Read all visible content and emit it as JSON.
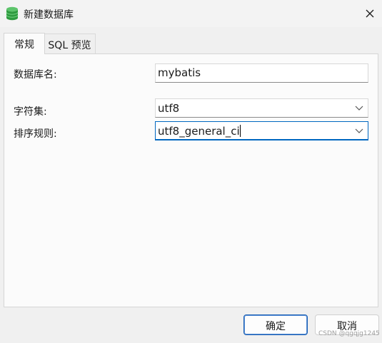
{
  "window": {
    "title": "新建数据库",
    "icon": "database-icon",
    "close_icon": "close-icon"
  },
  "tabs": [
    {
      "label": "常规",
      "active": true
    },
    {
      "label": "SQL 预览",
      "active": false
    }
  ],
  "form": {
    "db_name": {
      "label": "数据库名:",
      "value": "mybatis"
    },
    "charset": {
      "label": "字符集:",
      "value": "utf8"
    },
    "collation": {
      "label": "排序规则:",
      "value": "utf8_general_ci"
    }
  },
  "buttons": {
    "ok": "确定",
    "cancel": "取消"
  },
  "watermark": "CSDN @qgqjg1245",
  "colors": {
    "accent": "#0067c0",
    "db_icon": "#2e9b3f"
  }
}
